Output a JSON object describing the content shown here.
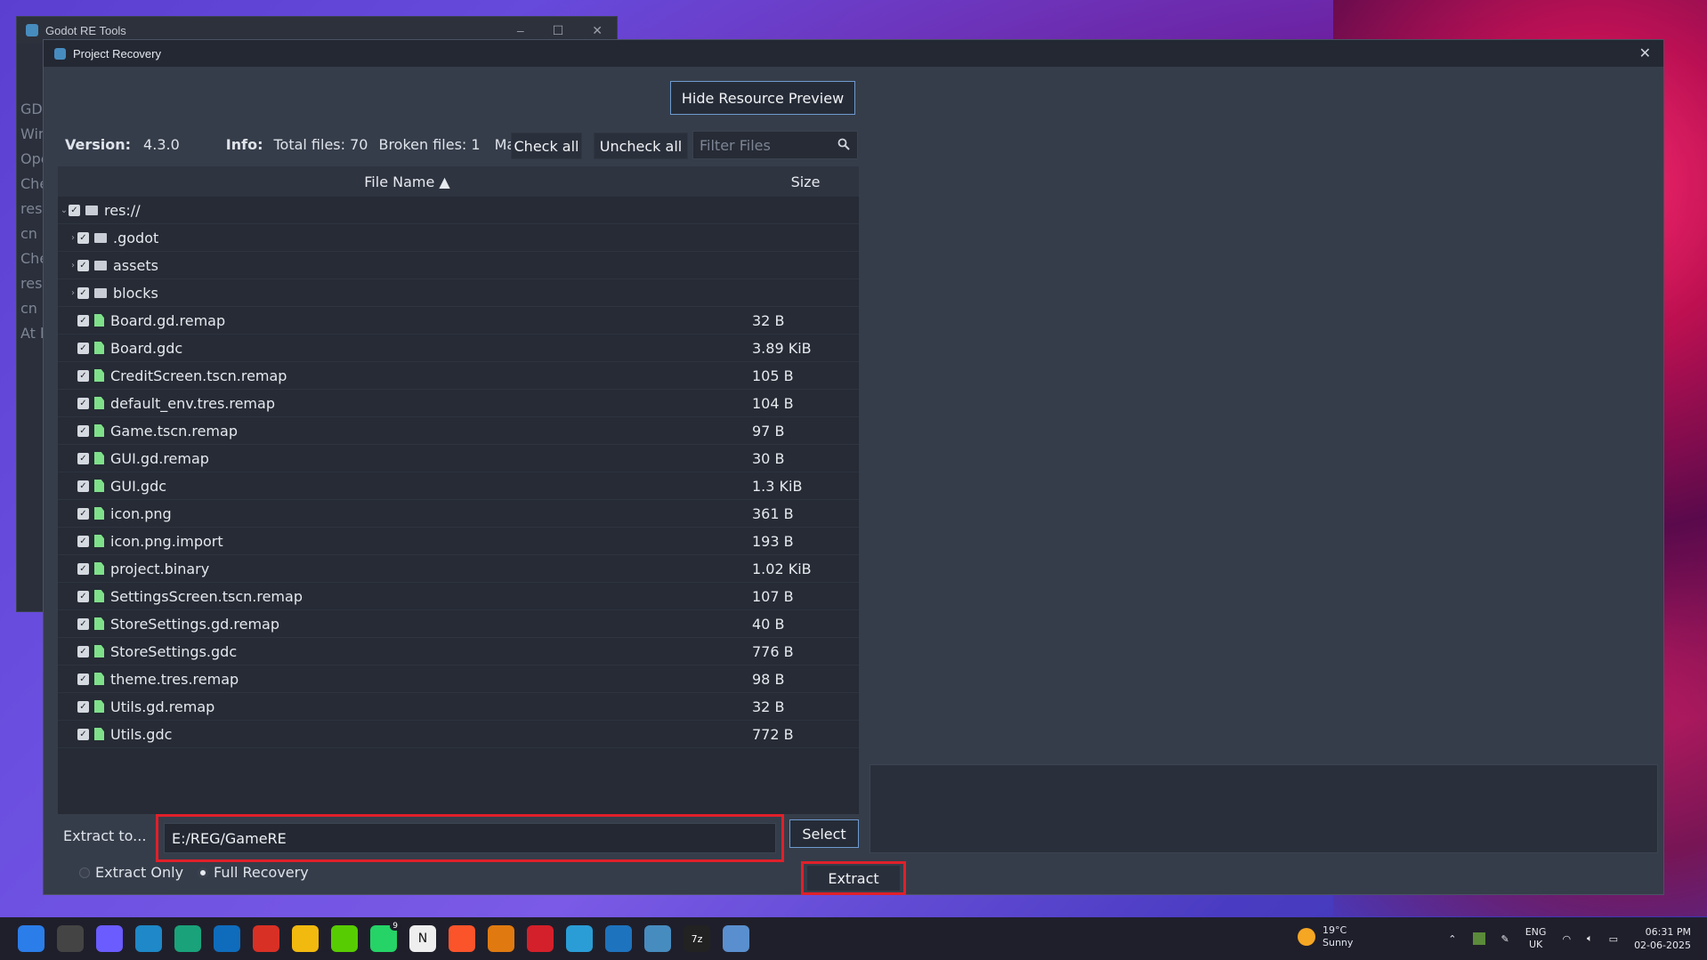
{
  "bg_window": {
    "title": "Godot RE Tools",
    "side_lines": [
      "GDI",
      "Win",
      "Ope",
      "Che",
      "res:",
      "cn",
      "Che",
      "res:",
      "cn",
      "At l"
    ]
  },
  "dialog": {
    "title": "Project Recovery",
    "hide_preview_label": "Hide Resource Preview",
    "version_label": "Version:",
    "version_value": "4.3.0",
    "info_label": "Info:",
    "total_files": "Total files: 70",
    "broken_files": "Broken files: 1",
    "truncated": "Malf",
    "check_all": "Check all",
    "uncheck_all": "Uncheck all",
    "filter_placeholder": "Filter Files",
    "col_name": "File Name ▲",
    "col_size": "Size",
    "extract_label": "Extract to...",
    "extract_path": "E:/REG/GameRE",
    "select_label": "Select",
    "radio_extract_only": "Extract Only",
    "radio_full_recovery": "Full Recovery",
    "extract_button": "Extract"
  },
  "tree": [
    {
      "name": "res://",
      "size": "",
      "type": "folder",
      "depth": 0,
      "expanded": true
    },
    {
      "name": ".godot",
      "size": "",
      "type": "folder",
      "depth": 1,
      "expanded": false
    },
    {
      "name": "assets",
      "size": "",
      "type": "folder",
      "depth": 1,
      "expanded": false
    },
    {
      "name": "blocks",
      "size": "",
      "type": "folder",
      "depth": 1,
      "expanded": false
    },
    {
      "name": "Board.gd.remap",
      "size": "32 B",
      "type": "file",
      "depth": 1
    },
    {
      "name": "Board.gdc",
      "size": "3.89 KiB",
      "type": "file",
      "depth": 1
    },
    {
      "name": "CreditScreen.tscn.remap",
      "size": "105 B",
      "type": "file",
      "depth": 1
    },
    {
      "name": "default_env.tres.remap",
      "size": "104 B",
      "type": "file",
      "depth": 1
    },
    {
      "name": "Game.tscn.remap",
      "size": "97 B",
      "type": "file",
      "depth": 1
    },
    {
      "name": "GUI.gd.remap",
      "size": "30 B",
      "type": "file",
      "depth": 1
    },
    {
      "name": "GUI.gdc",
      "size": "1.3 KiB",
      "type": "file",
      "depth": 1
    },
    {
      "name": "icon.png",
      "size": "361 B",
      "type": "file",
      "depth": 1
    },
    {
      "name": "icon.png.import",
      "size": "193 B",
      "type": "file",
      "depth": 1
    },
    {
      "name": "project.binary",
      "size": "1.02 KiB",
      "type": "file",
      "depth": 1
    },
    {
      "name": "SettingsScreen.tscn.remap",
      "size": "107 B",
      "type": "file",
      "depth": 1
    },
    {
      "name": "StoreSettings.gd.remap",
      "size": "40 B",
      "type": "file",
      "depth": 1
    },
    {
      "name": "StoreSettings.gdc",
      "size": "776 B",
      "type": "file",
      "depth": 1
    },
    {
      "name": "theme.tres.remap",
      "size": "98 B",
      "type": "file",
      "depth": 1
    },
    {
      "name": "Utils.gd.remap",
      "size": "32 B",
      "type": "file",
      "depth": 1
    },
    {
      "name": "Utils.gdc",
      "size": "772 B",
      "type": "file",
      "depth": 1
    }
  ],
  "taskbar": {
    "weather_temp": "19°C",
    "weather_desc": "Sunny",
    "lang_top": "ENG",
    "lang_bottom": "UK",
    "time": "06:31 PM",
    "date": "02-06-2025",
    "icons": [
      "start-icon",
      "task-view-icon",
      "copilot-icon",
      "edge-icon",
      "edge-dev-icon",
      "outlook-icon",
      "gmail-icon",
      "file-explorer-icon",
      "duolingo-icon",
      "whatsapp-icon",
      "notion-icon",
      "brave-icon",
      "office-icon",
      "acrobat-icon",
      "script-icon",
      "sharing-icon",
      "godot-re-icon",
      "7zip-icon",
      "godot-icon"
    ],
    "whatsapp_badge": "9"
  }
}
